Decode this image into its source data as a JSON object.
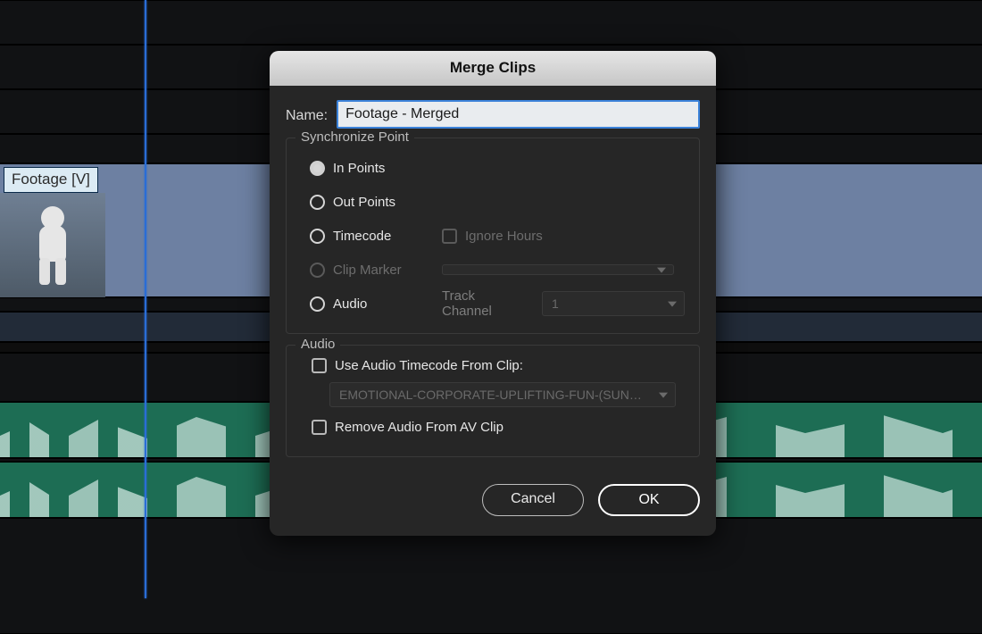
{
  "timeline": {
    "clip_label": "Footage [V]"
  },
  "dialog": {
    "title": "Merge Clips",
    "name_label": "Name:",
    "name_value": "Footage - Merged",
    "sync": {
      "legend": "Synchronize Point",
      "in_points": "In Points",
      "out_points": "Out Points",
      "timecode": "Timecode",
      "ignore_hours": "Ignore Hours",
      "clip_marker": "Clip Marker",
      "clip_marker_value": "",
      "audio": "Audio",
      "track_channel_label": "Track Channel",
      "track_channel_value": "1"
    },
    "audio": {
      "legend": "Audio",
      "use_tc": "Use Audio Timecode From Clip:",
      "clip_select_value": "EMOTIONAL-CORPORATE-UPLIFTING-FUN-(SUN…",
      "remove": "Remove Audio From AV Clip"
    },
    "buttons": {
      "cancel": "Cancel",
      "ok": "OK"
    }
  }
}
